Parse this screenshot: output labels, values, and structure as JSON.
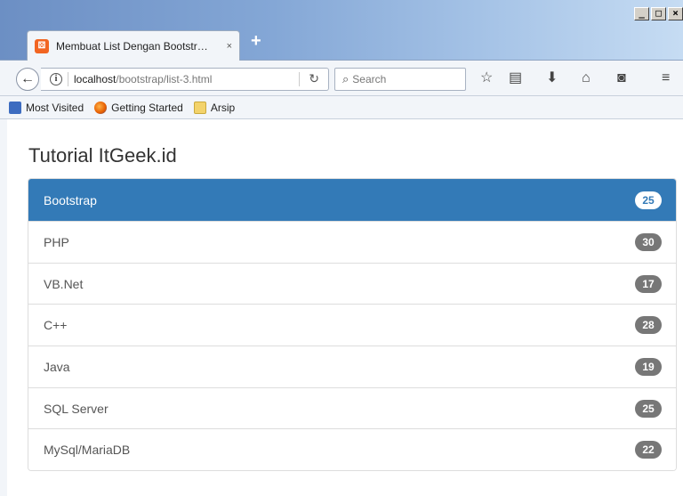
{
  "window": {
    "controls": [
      "_",
      "□",
      "×"
    ]
  },
  "tab": {
    "title": "Membuat List Dengan Bootstr…",
    "favicon_glyph": "⚄",
    "close": "×",
    "new_tab": "+"
  },
  "navbar": {
    "url_host": "localhost",
    "url_path": "/bootstrap/list-3.html",
    "search_placeholder": "Search",
    "icons": [
      "back-icon",
      "info-icon",
      "reload-icon",
      "search-icon",
      "star-icon",
      "reading-list-icon",
      "download-icon",
      "home-icon",
      "pocket-icon",
      "menu-icon"
    ]
  },
  "bookmarks": [
    {
      "label": "Most Visited",
      "icon": "most-visited-icon"
    },
    {
      "label": "Getting Started",
      "icon": "firefox-icon"
    },
    {
      "label": "Arsip",
      "icon": "folder-icon"
    }
  ],
  "page": {
    "title": "Tutorial ItGeek.id",
    "items": [
      {
        "label": "Bootstrap",
        "count": "25"
      },
      {
        "label": "PHP",
        "count": "30"
      },
      {
        "label": "VB.Net",
        "count": "17"
      },
      {
        "label": "C++",
        "count": "28"
      },
      {
        "label": "Java",
        "count": "19"
      },
      {
        "label": "SQL Server",
        "count": "25"
      },
      {
        "label": "MySql/MariaDB",
        "count": "22"
      }
    ]
  },
  "colors": {
    "active": "#337ab7",
    "badge": "#777777",
    "text": "#555555"
  }
}
